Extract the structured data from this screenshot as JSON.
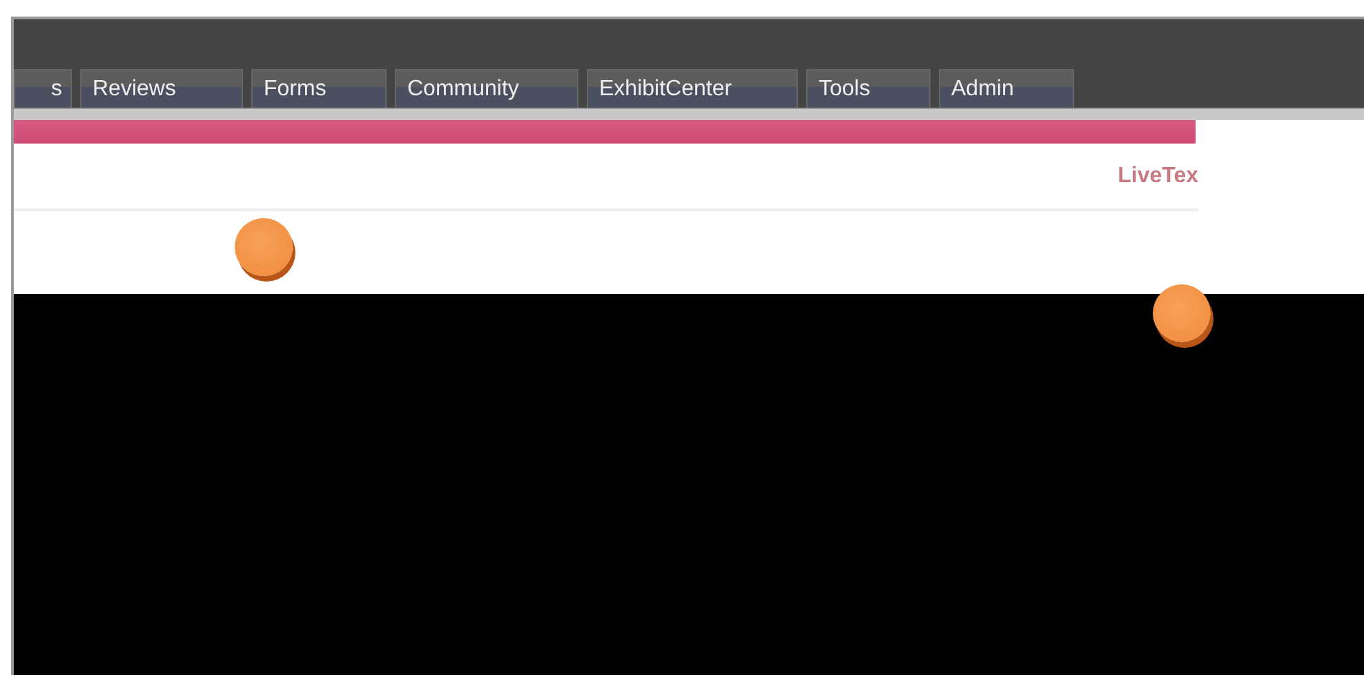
{
  "tabs": [
    {
      "label": "s"
    },
    {
      "label": "Reviews"
    },
    {
      "label": "Forms"
    },
    {
      "label": "Community"
    },
    {
      "label": "ExhibitCenter"
    },
    {
      "label": "Tools"
    },
    {
      "label": "Admin"
    }
  ],
  "header": {
    "brand": "LiveTex"
  }
}
